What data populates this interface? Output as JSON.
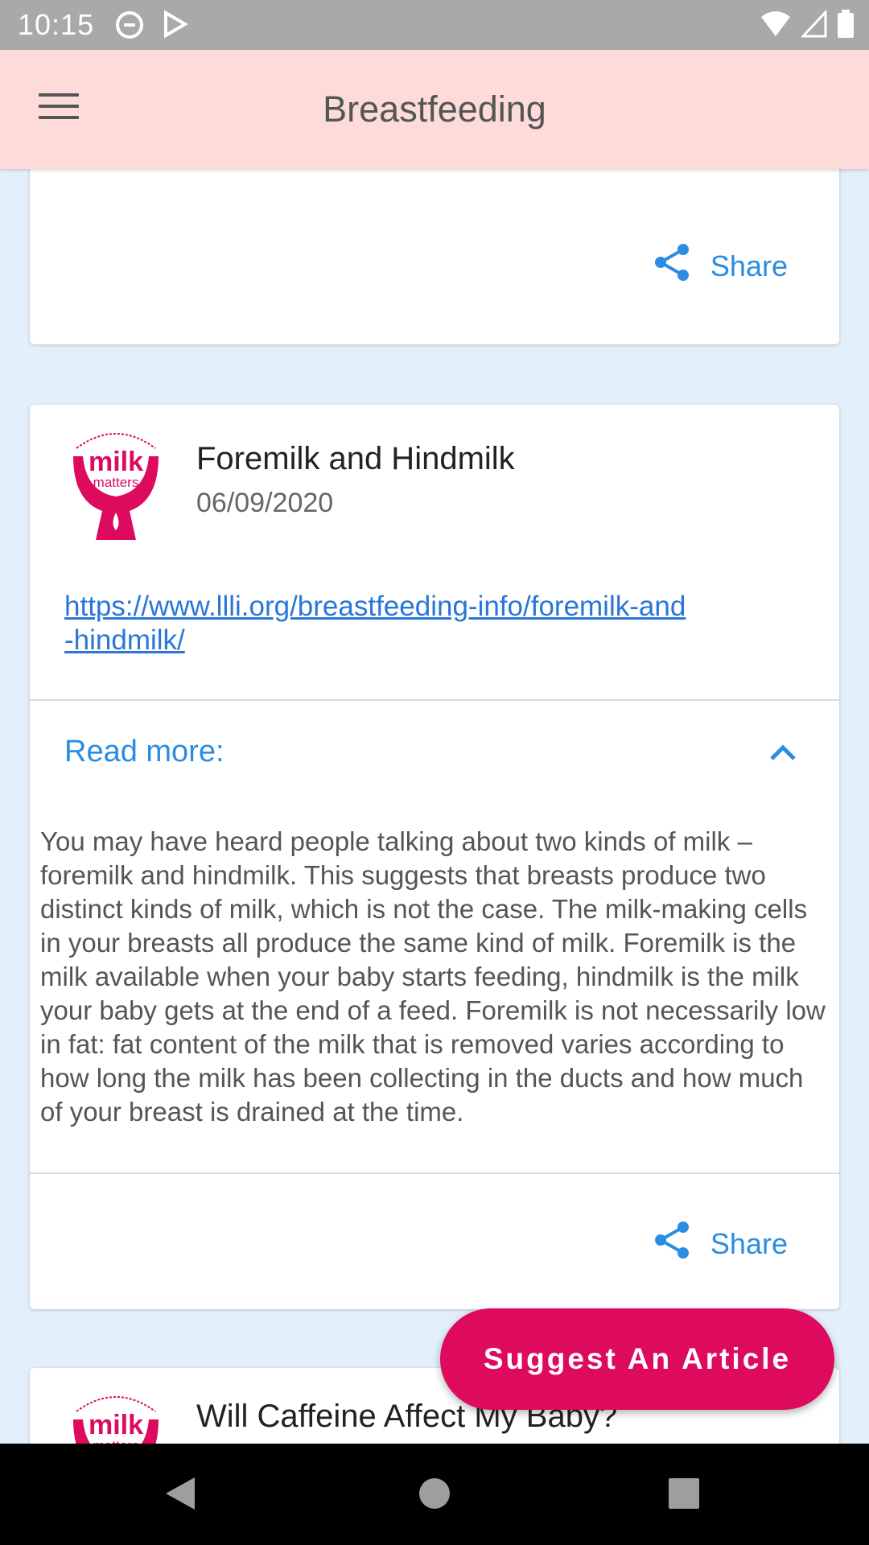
{
  "status_bar": {
    "time": "10:15"
  },
  "app_bar": {
    "title": "Breastfeeding"
  },
  "top_card": {
    "share_label": "Share"
  },
  "article": {
    "logo_text": "milk",
    "logo_subtext": "matters",
    "logo_arc": "mothers expressing for others",
    "title": "Foremilk and Hindmilk",
    "date": "06/09/2020",
    "link_line1": "https://www.llli.org/breastfeeding-info/foremilk-and",
    "link_line2": "-hindmilk/",
    "read_more_label": "Read more:",
    "body": "You may have heard people talking about two kinds of milk – foremilk and hindmilk. This suggests that breasts produce two distinct kinds of milk, which is not the case. The milk-making cells in your breasts all produce the same kind of milk.  Foremilk is the milk available when your baby starts feeding, hindmilk is the milk your baby gets at the end of a feed. Foremilk is not necessarily low in fat: fat content of the milk that is removed varies according to how long the milk has been collecting in the ducts and how much of your breast is drained at the time.",
    "share_label": "Share"
  },
  "next_article": {
    "logo_text": "milk",
    "logo_subtext": "matters",
    "title": "Will Caffeine Affect My Baby?"
  },
  "fab": {
    "label": "Suggest An Article"
  },
  "colors": {
    "accent": "#2a8de2",
    "brand": "#dd0a5e",
    "appbar": "#fddbd8",
    "background": "#e3effa"
  }
}
